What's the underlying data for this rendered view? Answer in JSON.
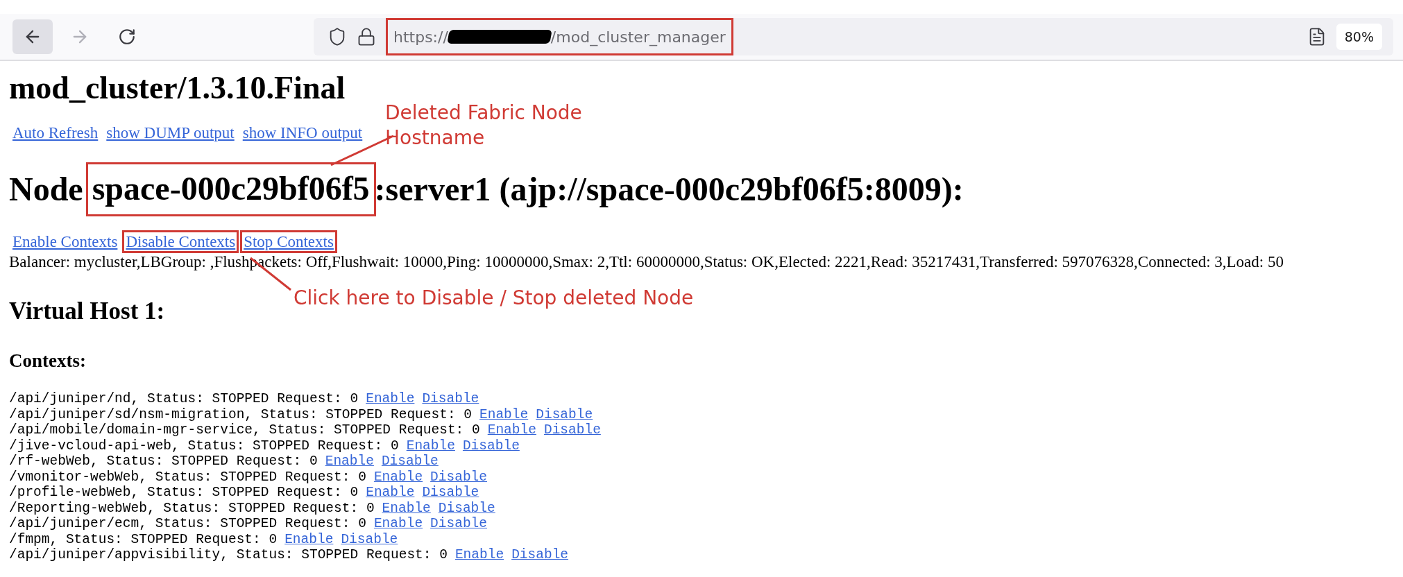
{
  "toolbar": {
    "nav": [
      {
        "kind": "back",
        "disabled": false
      },
      {
        "kind": "forward",
        "disabled": true
      },
      {
        "kind": "reload",
        "disabled": false
      }
    ],
    "address": {
      "scheme": "https://",
      "path": "/mod_cluster_manager",
      "redacted": true,
      "highlighted": true
    },
    "zoom": "80%"
  },
  "title": "mod_cluster/1.3.10.Final",
  "top_links": [
    "Auto Refresh",
    "show DUMP output",
    "show INFO output"
  ],
  "node_heading": {
    "prefix": "Node",
    "hostname": "space-000c29bf06f5",
    "hostname_highlighted": true,
    "suffix": ":server1 (ajp://space-000c29bf06f5:8009):"
  },
  "node_links": [
    {
      "label": "Enable Contexts",
      "highlighted": false
    },
    {
      "label": "Disable Contexts",
      "highlighted": true
    },
    {
      "label": "Stop Contexts",
      "highlighted": true
    }
  ],
  "balancer": "Balancer: mycluster,LBGroup: ,Flushpackets: Off,Flushwait: 10000,Ping: 10000000,Smax: 2,Ttl: 60000000,Status: OK,Elected: 2221,Read: 35217431,Transferred: 597076328,Connected: 3,Load: 50",
  "virtual_host": "Virtual Host 1:",
  "contexts_heading": "Contexts:",
  "contexts": [
    {
      "text": "/api/juniper/nd, Status: STOPPED Request: 0",
      "links": [
        "Enable",
        "Disable"
      ]
    },
    {
      "text": "/api/juniper/sd/nsm-migration, Status: STOPPED Request: 0",
      "links": [
        "Enable",
        "Disable"
      ]
    },
    {
      "text": "/api/mobile/domain-mgr-service, Status: STOPPED Request: 0",
      "links": [
        "Enable",
        "Disable"
      ]
    },
    {
      "text": "/jive-vcloud-api-web, Status: STOPPED Request: 0",
      "links": [
        "Enable",
        "Disable"
      ]
    },
    {
      "text": "/rf-webWeb, Status: STOPPED Request: 0",
      "links": [
        "Enable",
        "Disable"
      ]
    },
    {
      "text": "/vmonitor-webWeb, Status: STOPPED Request: 0",
      "links": [
        "Enable",
        "Disable"
      ]
    },
    {
      "text": "/profile-webWeb, Status: STOPPED Request: 0",
      "links": [
        "Enable",
        "Disable"
      ]
    },
    {
      "text": "/Reporting-webWeb, Status: STOPPED Request: 0",
      "links": [
        "Enable",
        "Disable"
      ]
    },
    {
      "text": "/api/juniper/ecm, Status: STOPPED Request: 0",
      "links": [
        "Enable",
        "Disable"
      ]
    },
    {
      "text": "/fmpm, Status: STOPPED Request: 0",
      "links": [
        "Enable",
        "Disable"
      ]
    },
    {
      "text": "/api/juniper/appvisibility, Status: STOPPED Request: 0",
      "links": [
        "Enable",
        "Disable"
      ]
    }
  ],
  "annotations": [
    {
      "kind": "hostname",
      "lines": [
        "Deleted Fabric Node",
        "Hostname"
      ]
    },
    {
      "kind": "links",
      "lines": [
        "Click here to Disable / Stop deleted Node"
      ]
    }
  ]
}
